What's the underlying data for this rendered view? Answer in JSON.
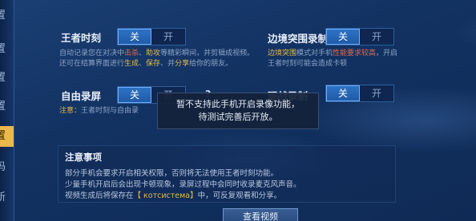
{
  "sidebar": {
    "tabs": [
      {
        "label": "置"
      },
      {
        "label": "置"
      },
      {
        "label": "置"
      },
      {
        "label": "置"
      },
      {
        "label": "置",
        "active": true
      },
      {
        "label": "码"
      },
      {
        "label": "新"
      }
    ]
  },
  "settings": {
    "king_moment": {
      "label": "王者时刻",
      "on_label": "关",
      "off_label": "开",
      "desc_line1_pre": "自动记录您在对决中",
      "desc_line1_hl1": "击杀",
      "desc_line1_sep": "、",
      "desc_line1_hl2": "助攻",
      "desc_line1_post": "等精彩瞬间，并剪辑成视频。",
      "desc_line2_pre": "还可在结算界面进行",
      "desc_line2_hl1": "生成",
      "desc_line2_sep1": "、",
      "desc_line2_hl2": "保存",
      "desc_line2_sep2": "、并",
      "desc_line2_hl3": "分享",
      "desc_line2_post": "给你的朋友。"
    },
    "edge_breakout": {
      "label": "边境突围录制",
      "on_label": "关",
      "off_label": "开",
      "desc_line1_hl": "边境突围",
      "desc_line1_mid": "模式对手机",
      "desc_line1_hl2": "性能要求较高",
      "desc_line1_post": "，开启",
      "desc_line2": "王者时刻可能会造成卡顿"
    },
    "free_record": {
      "label": "自由录屏",
      "on_label": "关",
      "off_label": "开",
      "help": "?",
      "note_prefix": "注意：",
      "note_text": "王者时刻与自由录"
    },
    "watch_record": {
      "label": "观战录制",
      "on_label": "关",
      "off_label": "开"
    }
  },
  "toast": {
    "line1": "暂不支持此手机开启录像功能，",
    "line2": "待测试完善后开放。"
  },
  "notes": {
    "title": "注意事项",
    "line1": "部分手机会要求开启相关权限，否则将无法使用王者时刻功能。",
    "line2": "少量手机开启后会出现卡顿现象，录屏过程中会同时收录麦克风声音。",
    "line3_pre": "视频生成后将保存在",
    "line3_link": "【 котсистема】",
    "line3_post": "中，可反复观看和分享。"
  },
  "buttons": {
    "view_videos": "查看视频"
  }
}
